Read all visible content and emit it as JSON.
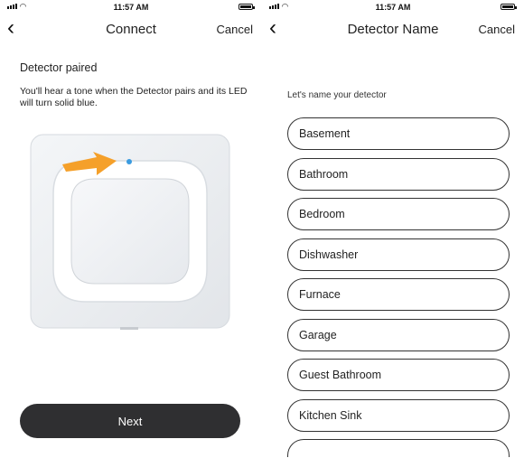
{
  "left": {
    "status": {
      "time": "11:57 AM"
    },
    "nav": {
      "back": "‹",
      "title": "Connect",
      "cancel": "Cancel"
    },
    "heading": "Detector paired",
    "description": "You'll hear a tone when the Detector pairs and its LED will turn solid blue.",
    "next_label": "Next",
    "colors": {
      "led": "#3a9be0",
      "arrow": "#f5a02a",
      "button": "#2f2f31"
    }
  },
  "right": {
    "status": {
      "time": "11:57 AM"
    },
    "nav": {
      "back": "‹",
      "title": "Detector Name",
      "cancel": "Cancel"
    },
    "prompt": "Let's name your detector",
    "options": [
      "Basement",
      "Bathroom",
      "Bedroom",
      "Dishwasher",
      "Furnace",
      "Garage",
      "Guest Bathroom",
      "Kitchen Sink"
    ]
  }
}
